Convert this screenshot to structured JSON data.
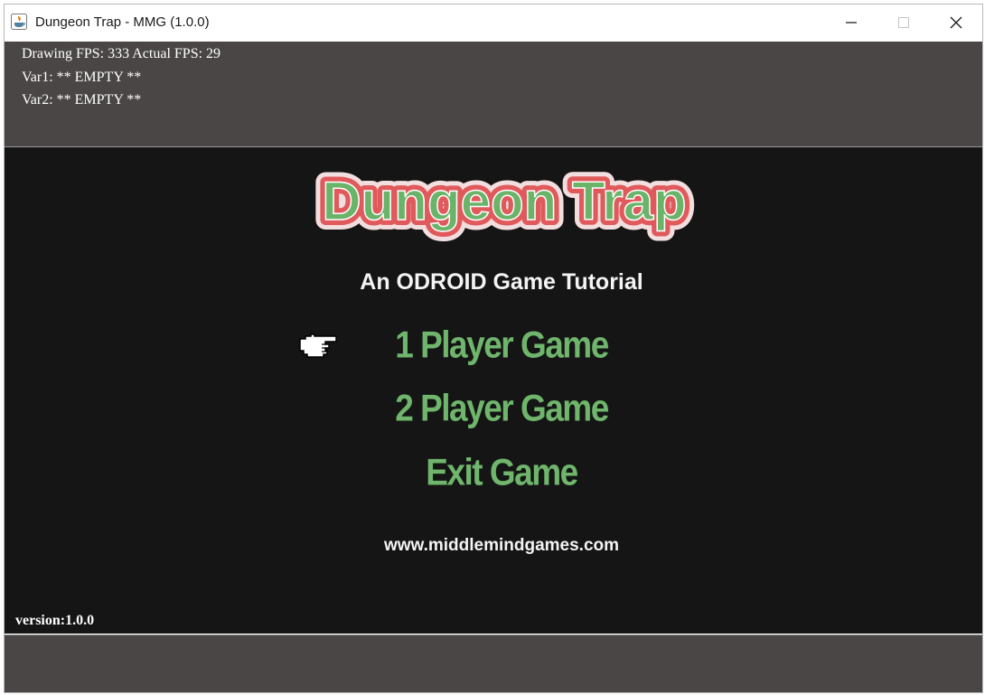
{
  "window": {
    "title": "Dungeon Trap - MMG (1.0.0)",
    "app_icon": "java-icon",
    "controls": [
      "minimize-icon",
      "maximize-icon",
      "close-icon"
    ]
  },
  "debug": {
    "fps_line": "Drawing FPS: 333 Actual FPS: 29",
    "var1_line": "Var1: ** EMPTY **",
    "var2_line": "Var2: ** EMPTY **"
  },
  "game": {
    "logo_text": "Dungeon Trap",
    "subtitle": "An ODROID Game Tutorial",
    "menu": [
      {
        "label": "1 Player Game",
        "selected": true
      },
      {
        "label": "2 Player Game",
        "selected": false
      },
      {
        "label": "Exit Game",
        "selected": false
      }
    ],
    "selector_icon": "pointing-hand-icon",
    "website": "www.middlemindgames.com",
    "version": "version:1.0.0"
  },
  "colors": {
    "panel": "#494645",
    "game_bg": "#151516",
    "menu_green": "#6fb56b",
    "logo_fill": "#6ab469",
    "logo_outline": "#e05a5c",
    "logo_glow": "#f2dede"
  }
}
